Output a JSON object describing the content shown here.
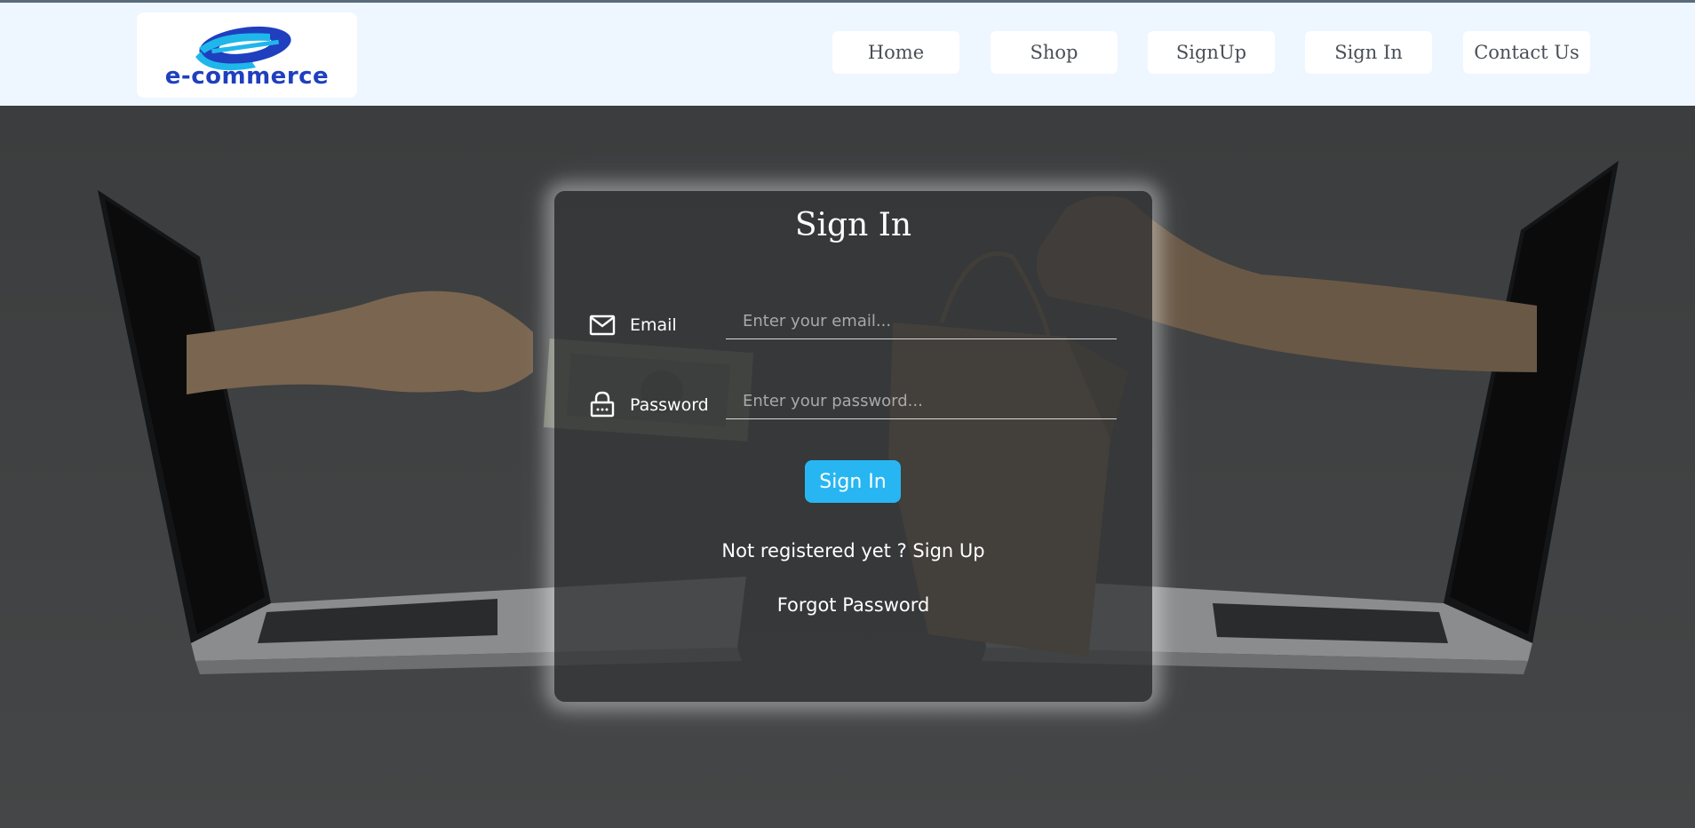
{
  "logo": {
    "text": "e-commerce",
    "colors": {
      "top": "#1fb7ea",
      "bottom": "#1f3fbf"
    }
  },
  "nav": {
    "items": [
      {
        "label": "Home"
      },
      {
        "label": "Shop"
      },
      {
        "label": "SignUp"
      },
      {
        "label": "Sign In"
      },
      {
        "label": "Contact Us"
      }
    ]
  },
  "form": {
    "title": "Sign In",
    "email": {
      "label": "Email",
      "placeholder": "Enter your email...",
      "icon": "mail-icon"
    },
    "password": {
      "label": "Password",
      "placeholder": "Enter your password...",
      "icon": "lock-icon"
    },
    "submit_label": "Sign In",
    "signup_link": "Not registered yet ? Sign Up",
    "forgot_link": "Forgot Password"
  },
  "colors": {
    "accent": "#27b6f2",
    "navbar_bg": "#eef6ff",
    "hero_bg": "#3f4142"
  }
}
